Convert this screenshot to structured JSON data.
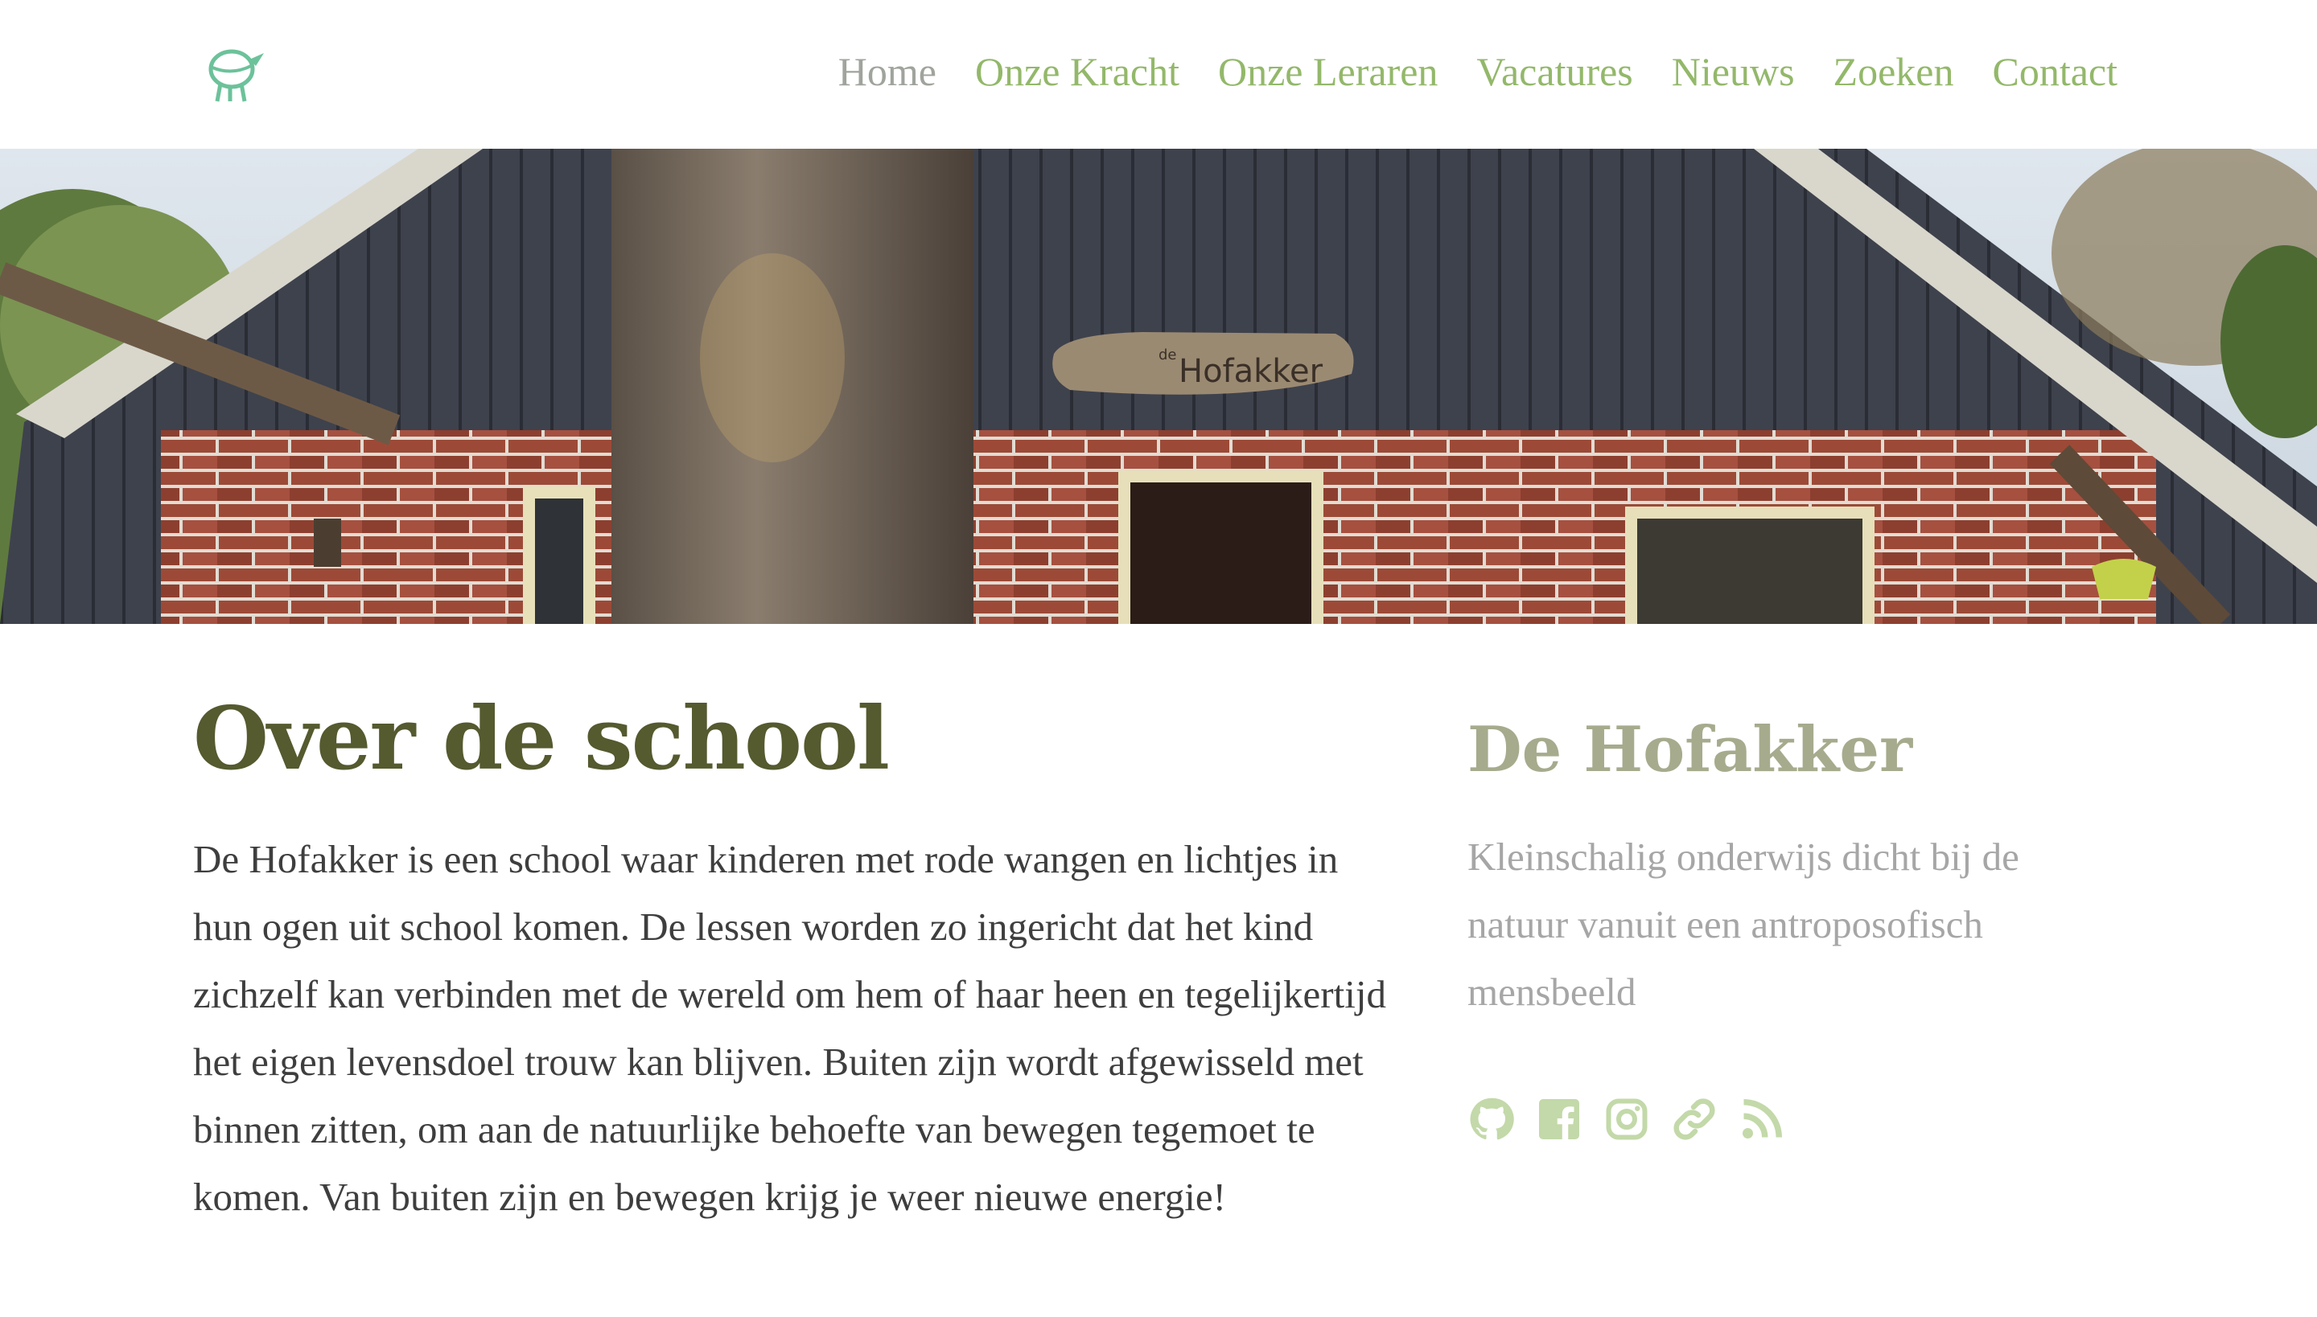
{
  "header": {
    "logo_name": "goat-logo-icon",
    "nav": [
      {
        "label": "Home",
        "active": true
      },
      {
        "label": "Onze Kracht"
      },
      {
        "label": "Onze Leraren"
      },
      {
        "label": "Vacatures"
      },
      {
        "label": "Nieuws"
      },
      {
        "label": "Zoeken"
      },
      {
        "label": "Contact"
      }
    ]
  },
  "hero": {
    "sign_text": "Hofakker",
    "sign_small": "de"
  },
  "main": {
    "title": "Over de school",
    "body": "De Hofakker is een school waar kinderen met rode wangen en lichtjes in hun ogen uit school komen. De lessen worden zo ingericht dat het kind zichzelf kan verbinden met de wereld om hem of haar heen en tegelijkertijd het eigen levensdoel trouw kan blijven. Buiten zijn wordt afgewisseld met binnen zitten, om aan de natuurlijke behoefte van bewegen tegemoet te komen. Van buiten zijn en bewegen krijg je weer nieuwe energie!"
  },
  "sidebar": {
    "title": "De Hofakker",
    "tagline": "Kleinschalig onderwijs dicht bij de natuur vanuit een antroposofisch mensbeeld",
    "social_icons": [
      "github-icon",
      "facebook-icon",
      "instagram-icon",
      "link-icon",
      "rss-icon"
    ]
  },
  "colors": {
    "accent": "#93b86a",
    "nav_active": "#9fa49c",
    "title": "#555a2f",
    "sidebar_title": "#a6ab8d",
    "icon": "#c3d9a9"
  }
}
